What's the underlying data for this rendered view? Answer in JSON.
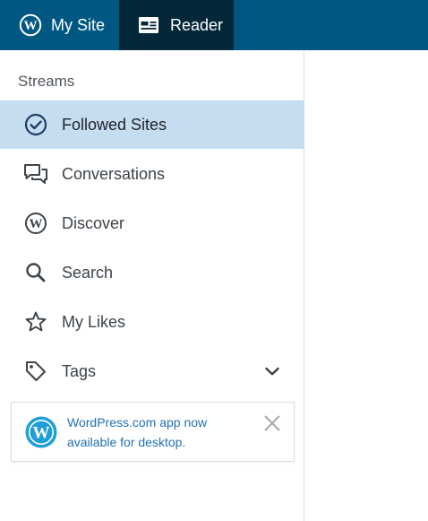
{
  "masterbar": {
    "my_site_label": "My Site",
    "reader_label": "Reader",
    "background": "#005882",
    "active_background": "#04283a"
  },
  "sidebar": {
    "heading": "Streams",
    "items": [
      {
        "label": "Followed Sites",
        "icon": "checkmark-circle-icon",
        "selected": true
      },
      {
        "label": "Conversations",
        "icon": "chat-bubbles-icon",
        "selected": false
      },
      {
        "label": "Discover",
        "icon": "wordpress-logo-icon",
        "selected": false
      },
      {
        "label": "Search",
        "icon": "search-icon",
        "selected": false
      },
      {
        "label": "My Likes",
        "icon": "star-icon",
        "selected": false
      },
      {
        "label": "Tags",
        "icon": "tag-icon",
        "selected": false,
        "expandable": true
      }
    ],
    "selected_background": "#c6dcef"
  },
  "app_notice": {
    "text": "WordPress.com app now available for desktop.",
    "logo_color": "#1f9fd8",
    "link_color": "#2271b1"
  }
}
